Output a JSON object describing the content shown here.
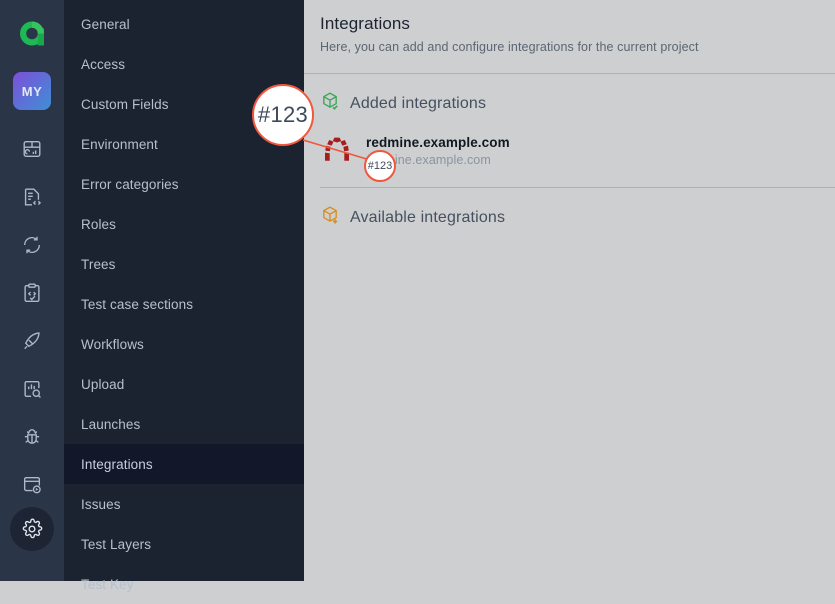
{
  "rail": {
    "logo_alt": "allure-logo",
    "project_badge": "MY",
    "items": [
      {
        "name": "dashboard-icon",
        "title": "Dashboard"
      },
      {
        "name": "test-cases-icon",
        "title": "Test cases"
      },
      {
        "name": "sync-icon",
        "title": "Sync"
      },
      {
        "name": "test-plan-icon",
        "title": "Test plan"
      },
      {
        "name": "launches-icon",
        "title": "Launches"
      },
      {
        "name": "analytics-icon",
        "title": "Analytics"
      },
      {
        "name": "defects-icon",
        "title": "Defects"
      },
      {
        "name": "live-docs-icon",
        "title": "Live docs"
      }
    ],
    "settings_label": "Settings"
  },
  "menu": {
    "items": [
      {
        "label": "General",
        "active": false
      },
      {
        "label": "Access",
        "active": false
      },
      {
        "label": "Custom Fields",
        "active": false
      },
      {
        "label": "Environment",
        "active": false
      },
      {
        "label": "Error categories",
        "active": false
      },
      {
        "label": "Roles",
        "active": false
      },
      {
        "label": "Trees",
        "active": false
      },
      {
        "label": "Test case sections",
        "active": false
      },
      {
        "label": "Workflows",
        "active": false
      },
      {
        "label": "Upload",
        "active": false
      },
      {
        "label": "Launches",
        "active": false
      },
      {
        "label": "Integrations",
        "active": true
      },
      {
        "label": "Issues",
        "active": false
      },
      {
        "label": "Test Layers",
        "active": false
      },
      {
        "label": "Test Key",
        "active": false
      }
    ]
  },
  "page": {
    "title": "Integrations",
    "subtitle": "Here, you can add and configure integrations for the current project"
  },
  "added_section": {
    "icon": "cube-check-icon",
    "icon_color": "#3aa655",
    "title": "Added integrations",
    "integrations": [
      {
        "logo": "redmine-logo",
        "name": "redmine.example.com",
        "url": "redmine.example.com"
      }
    ]
  },
  "available_section": {
    "icon": "cube-plus-icon",
    "icon_color": "#d98c1a",
    "title": "Available integrations",
    "integrations": []
  },
  "annotation": {
    "accent_color": "#f0573d",
    "bubble_label": "#123",
    "marker_label": "#123"
  }
}
